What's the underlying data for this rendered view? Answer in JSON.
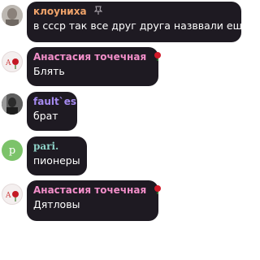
{
  "colors": {
    "bubble_bg": "#1e1a22",
    "name_kloun": "#f0a36a",
    "name_anastasia": "#f28ec9",
    "name_fault": "#a58af0",
    "name_pari": "#8fd3c9",
    "message_text": "#ffffff"
  },
  "messages": [
    {
      "author": "клоуниха",
      "badge": "pin-icon",
      "text": "в ссср так все друг друга назввали еще"
    },
    {
      "author": "Анастасия точечная",
      "badge": "rose-icon",
      "text": "Блять"
    },
    {
      "author": "fault`es",
      "text": "брат"
    },
    {
      "author": "pari.",
      "avatar_letter": "p",
      "text": "пионеры"
    },
    {
      "author": "Анастасия точечная",
      "badge": "rose-icon",
      "text": "Дятловы"
    }
  ]
}
